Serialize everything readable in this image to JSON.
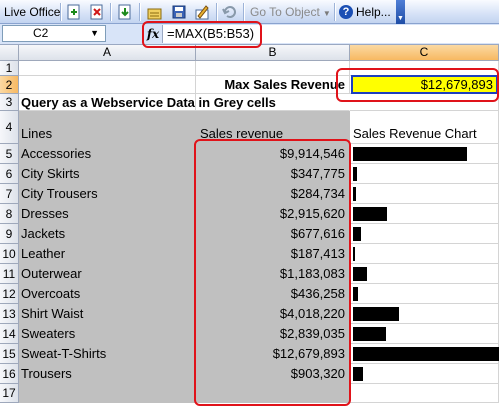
{
  "toolbar": {
    "live_office_label": "Live Office",
    "go_to_object_label": "Go To Object",
    "help_label": "Help...",
    "icons": [
      "insert-icon",
      "remove-icon",
      "refresh-object-icon",
      "properties-icon",
      "save-icon",
      "edit-icon",
      "undo-icon"
    ]
  },
  "formula_bar": {
    "name_box": "C2",
    "fx": "fx",
    "formula": "=MAX(B5:B53)"
  },
  "columns": {
    "a": "A",
    "b": "B",
    "c": "C"
  },
  "rows": [
    "1",
    "2",
    "3",
    "4",
    "5",
    "6",
    "7",
    "8",
    "9",
    "10",
    "11",
    "12",
    "13",
    "14",
    "15",
    "16",
    "17"
  ],
  "sheet": {
    "max_label": "Max Sales Revenue",
    "max_value": "$12,679,893",
    "query_title": "Query as a Webservice Data in Grey cells",
    "header_lines": "Lines",
    "header_revenue": "Sales revenue",
    "header_chart": "Sales Revenue Chart",
    "items": [
      {
        "line": "Accessories",
        "revenue": "$9,914,546",
        "value": 9914546
      },
      {
        "line": "City Skirts",
        "revenue": "$347,775",
        "value": 347775
      },
      {
        "line": "City Trousers",
        "revenue": "$284,734",
        "value": 284734
      },
      {
        "line": "Dresses",
        "revenue": "$2,915,620",
        "value": 2915620
      },
      {
        "line": "Jackets",
        "revenue": "$677,616",
        "value": 677616
      },
      {
        "line": "Leather",
        "revenue": "$187,413",
        "value": 187413
      },
      {
        "line": "Outerwear",
        "revenue": "$1,183,083",
        "value": 1183083
      },
      {
        "line": "Overcoats",
        "revenue": "$436,258",
        "value": 436258
      },
      {
        "line": "Shirt Waist",
        "revenue": "$4,018,220",
        "value": 4018220
      },
      {
        "line": "Sweaters",
        "revenue": "$2,839,035",
        "value": 2839035
      },
      {
        "line": "Sweat-T-Shirts",
        "revenue": "$12,679,893",
        "value": 12679893
      },
      {
        "line": "Trousers",
        "revenue": "$903,320",
        "value": 903320
      }
    ]
  },
  "colors": {
    "grey_cells": "#c0c0c0",
    "selected_fill": "#ffff00",
    "selection_border": "#1c3fbf",
    "annotation_red": "#e0131a",
    "bar": "#000000"
  }
}
